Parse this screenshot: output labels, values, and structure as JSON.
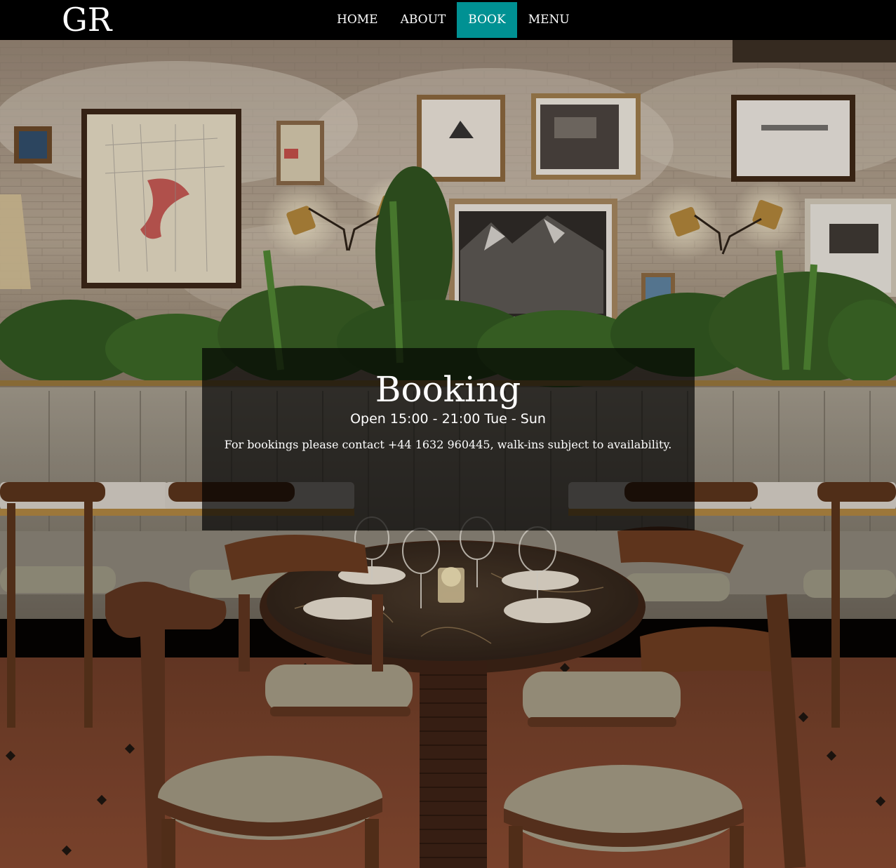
{
  "brand": {
    "logo_text": "GR"
  },
  "nav": {
    "items": [
      {
        "label": "HOME"
      },
      {
        "label": "ABOUT"
      },
      {
        "label": "BOOK"
      },
      {
        "label": "MENU"
      }
    ],
    "active": "BOOK"
  },
  "booking": {
    "title": "Booking",
    "hours": "Open 15:00 - 21:00 Tue - Sun",
    "description": "For bookings please contact +44 1632 960445, walk-ins subject to availability."
  },
  "colors": {
    "nav_background": "#000000",
    "nav_active": "#009193",
    "text": "#ffffff",
    "overlay": "rgba(0,0,0,0.68)"
  }
}
